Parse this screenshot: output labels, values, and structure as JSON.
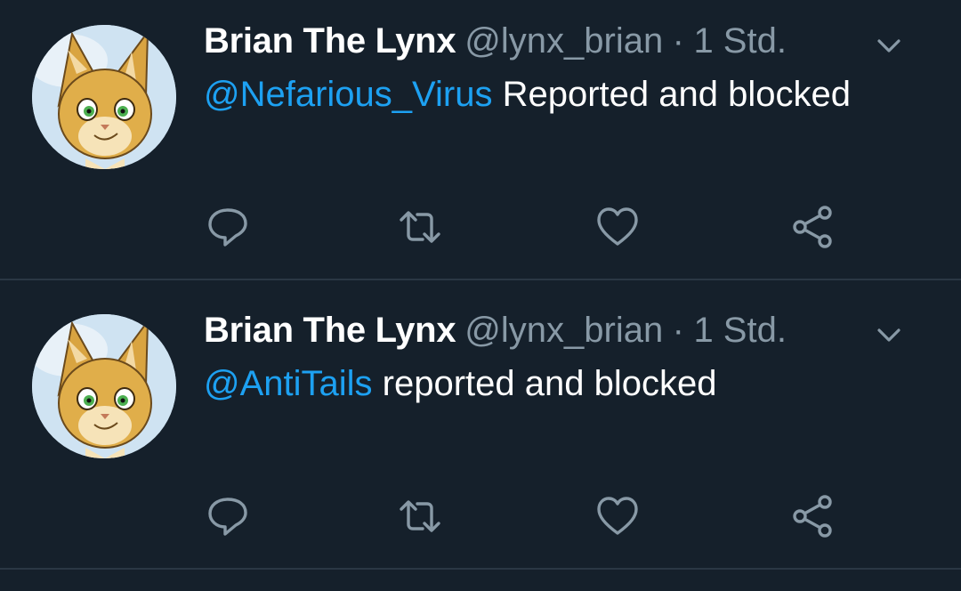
{
  "tweets": [
    {
      "author_name": "Brian The Lynx",
      "handle": "@lynx_brian",
      "separator": "·",
      "time": "1 Std.",
      "mention": "@Nefarious_Virus",
      "text": " Reported and blocked",
      "avatar_icon": "lynx-avatar",
      "actions": [
        "reply-icon",
        "retweet-icon",
        "like-icon",
        "share-icon"
      ]
    },
    {
      "author_name": "Brian The Lynx",
      "handle": "@lynx_brian",
      "separator": "·",
      "time": "1 Std.",
      "mention": "@AntiTails",
      "text": " reported and blocked",
      "avatar_icon": "lynx-avatar",
      "actions": [
        "reply-icon",
        "retweet-icon",
        "like-icon",
        "share-icon"
      ]
    }
  ],
  "colors": {
    "background": "#15202b",
    "text": "#ffffff",
    "secondary": "#8899a6",
    "mention": "#1da1f2",
    "divider": "#2a3744"
  }
}
